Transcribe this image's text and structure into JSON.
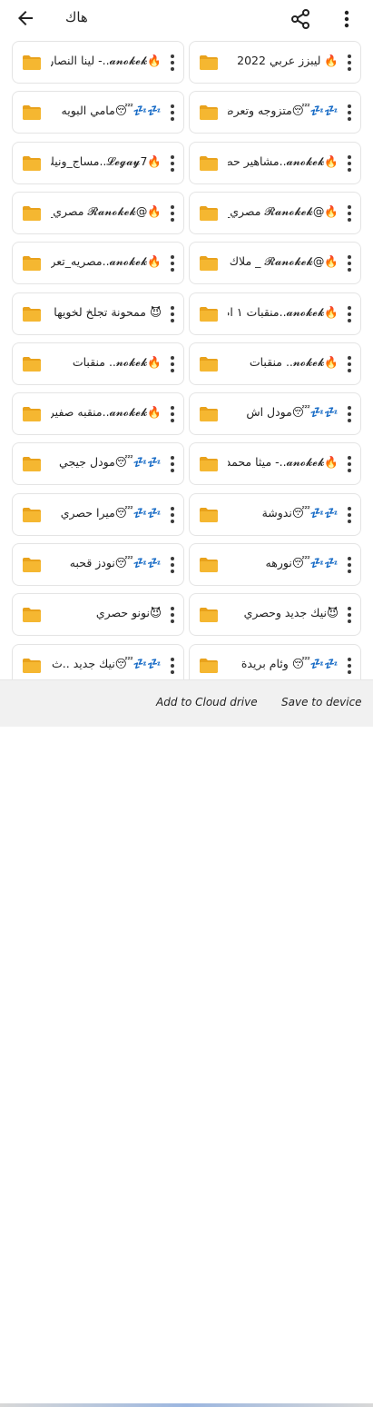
{
  "header": {
    "title": "هاك",
    "icons": {
      "back": "back-arrow-icon",
      "share": "share-icon",
      "more": "more-vert-icon"
    }
  },
  "colors": {
    "folder": "#F5B731",
    "folder_tab": "#E9A21C",
    "background": "#FFFFFF",
    "bottom_bar": "#F1F1F1"
  },
  "folders": [
    {
      "label": "🔥 ليبزز عربي 2022"
    },
    {
      "label": "🔥𝓪𝓷𝓸𝓴𝓮𝓴..- لينا النصار"
    },
    {
      "label": "💤💤😴متزوجه وتعرض"
    },
    {
      "label": "💤💤😴مامي البويه"
    },
    {
      "label": "🔥𝓪𝓷𝓸𝓴𝓮𝓴..مشاهير حص"
    },
    {
      "label": "🔥𝓛𝓮𝓰𝓪𝔂7..مساج_ونيك"
    },
    {
      "label": "🔥@𝓡𝓪𝓷𝓸𝓴𝓮𝓴 مصري_٣"
    },
    {
      "label": "🔥@𝓡𝓪𝓷𝓸𝓴𝓮𝓴 مصري_٢"
    },
    {
      "label": "🔥@𝓡𝓪𝓷𝓸𝓴𝓮𝓴 _ ملاك"
    },
    {
      "label": "🔥𝓪𝓷𝓸𝓴𝓮𝓴..مصريه_تعر"
    },
    {
      "label": "🔥𝓪𝓷𝓸𝓴𝓮𝓴..منقبات ١ ام"
    },
    {
      "label": "😈 ممحونة تجلخ لخويها"
    },
    {
      "label": "🔥𝓷𝓸𝓴𝓮𝓴.. منقبات"
    },
    {
      "label": "🔥𝓷𝓸𝓴𝓮𝓴.. منقبات"
    },
    {
      "label": "💤💤😴مودل اش"
    },
    {
      "label": "🔥𝓪𝓷𝓸𝓴𝓮𝓴..منقبه صفيره"
    },
    {
      "label": "🔥𝓪𝓷𝓸𝓴𝓮𝓴..- ميثا محمد"
    },
    {
      "label": "💤💤😴مودل جيجي"
    },
    {
      "label": "💤💤😴ندوشة"
    },
    {
      "label": "💤💤😴ميرا حصري"
    },
    {
      "label": "💤💤😴نورهه"
    },
    {
      "label": "💤💤😴نودز قحبه"
    },
    {
      "label": "😈نيك جديد وحصري"
    },
    {
      "label": "😈نونو حصري"
    },
    {
      "label": "💤💤😴 وئام بريدة"
    },
    {
      "label": "💤💤😴نيك جديد ..ث"
    }
  ],
  "bottom": {
    "cloud_label": "Add to Cloud drive",
    "save_label": "Save to device"
  }
}
